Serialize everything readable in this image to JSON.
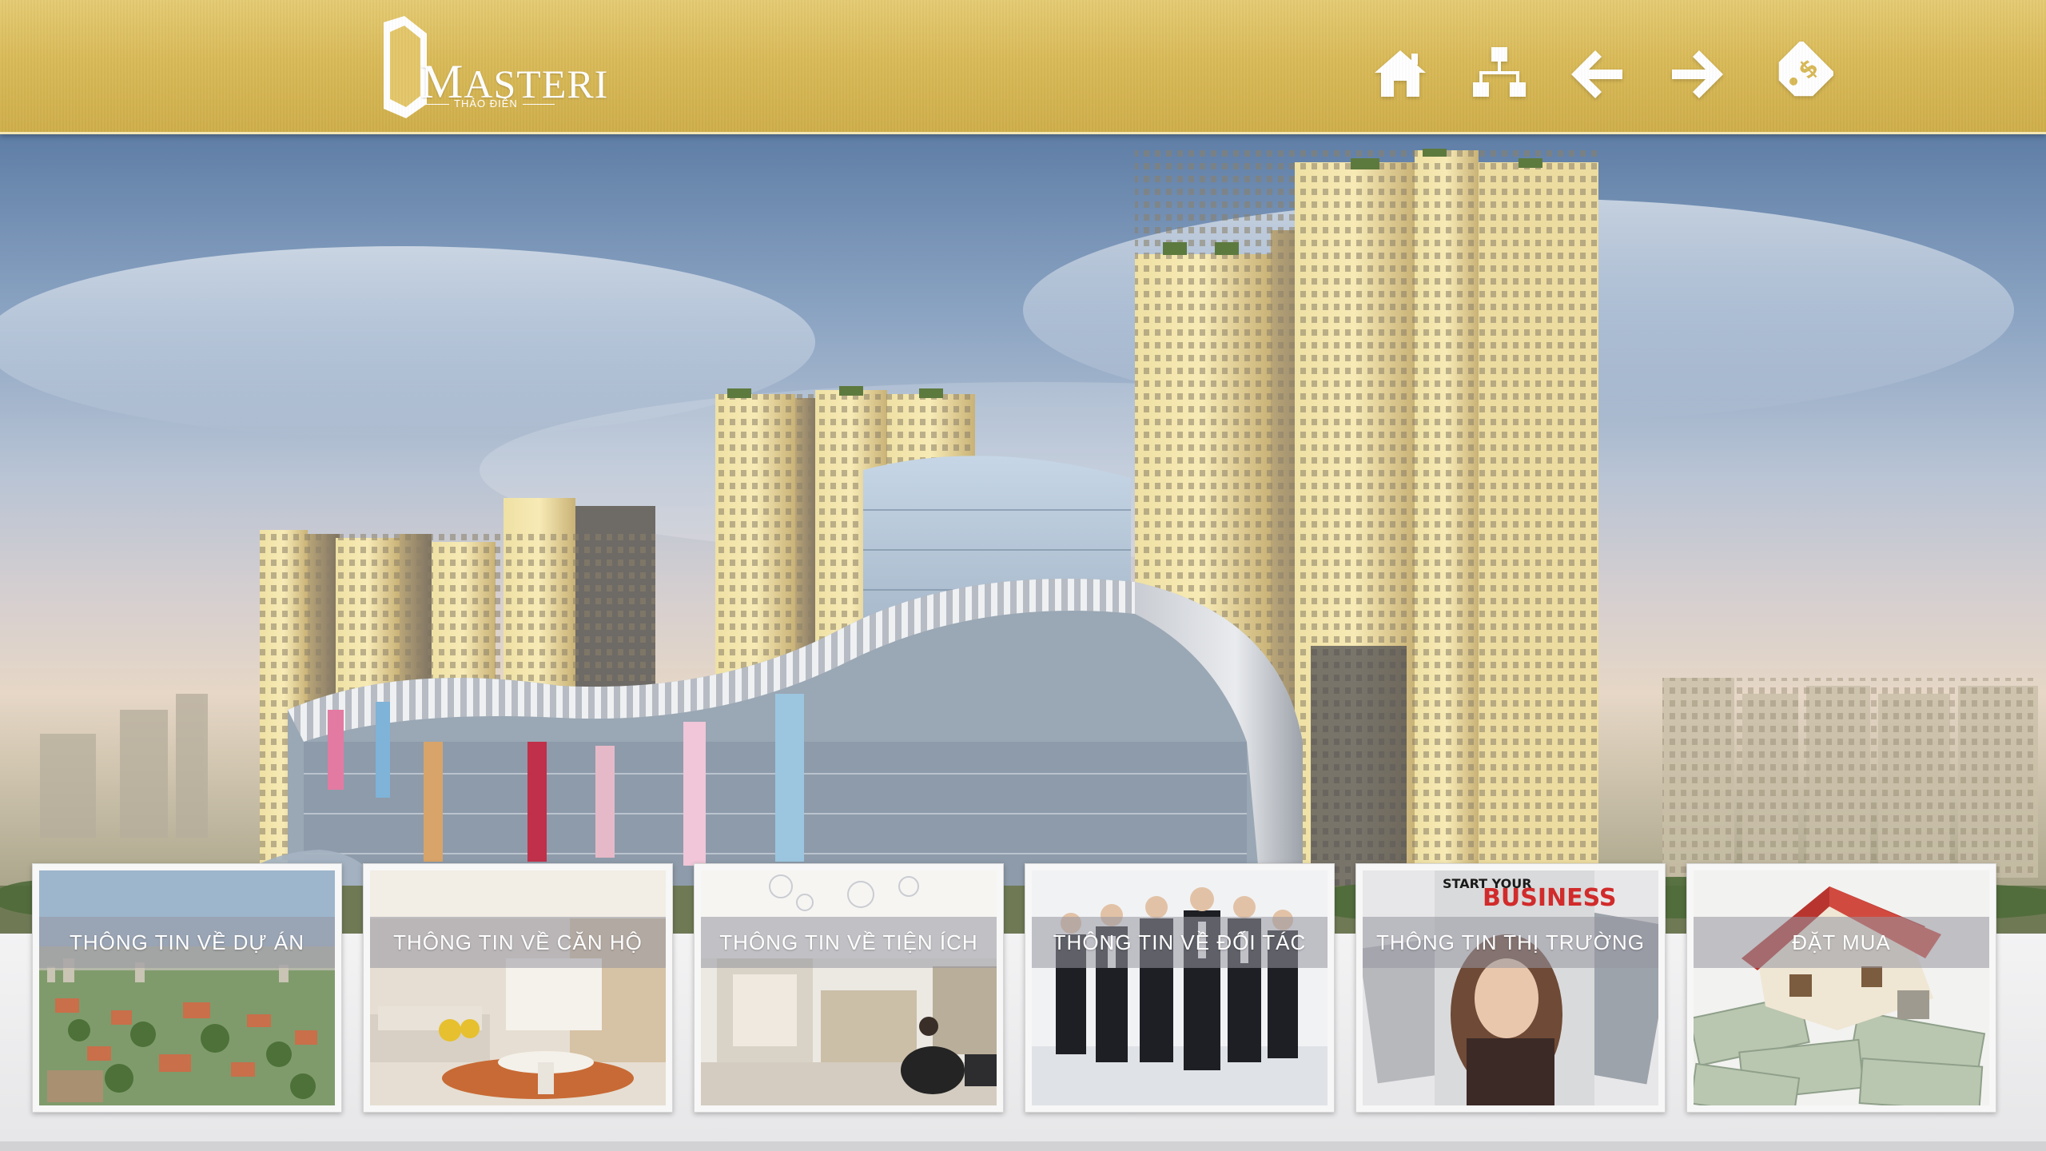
{
  "brand": {
    "name": "ASTERI",
    "initial": "M",
    "subtitle": "THẢO ĐIỀN",
    "color": "#ffffff"
  },
  "header": {
    "background": "#d9ba58",
    "nav": [
      {
        "icon": "home-icon"
      },
      {
        "icon": "sitemap-icon"
      },
      {
        "icon": "arrow-left-icon"
      },
      {
        "icon": "arrow-right-icon"
      },
      {
        "icon": "price-tag-icon"
      }
    ]
  },
  "tiles": [
    {
      "label": "THÔNG TIN VỀ DỰ ÁN",
      "image": "aerial-city-photo"
    },
    {
      "label": "THÔNG TIN VỀ CĂN HỘ",
      "image": "apartment-interior-photo"
    },
    {
      "label": "THÔNG TIN VỀ TIỆN ÍCH",
      "image": "lobby-photo"
    },
    {
      "label": "THÔNG TIN VỀ ĐỐI TÁC",
      "image": "business-team-photo"
    },
    {
      "label": "THÔNG TIN THỊ TRƯỜNG",
      "image": "magazine-photo"
    },
    {
      "label": "ĐẶT MUA",
      "image": "house-on-money-photo"
    }
  ],
  "magazine": {
    "title_top": "START YOUR",
    "title_main": "BUSINESS"
  }
}
